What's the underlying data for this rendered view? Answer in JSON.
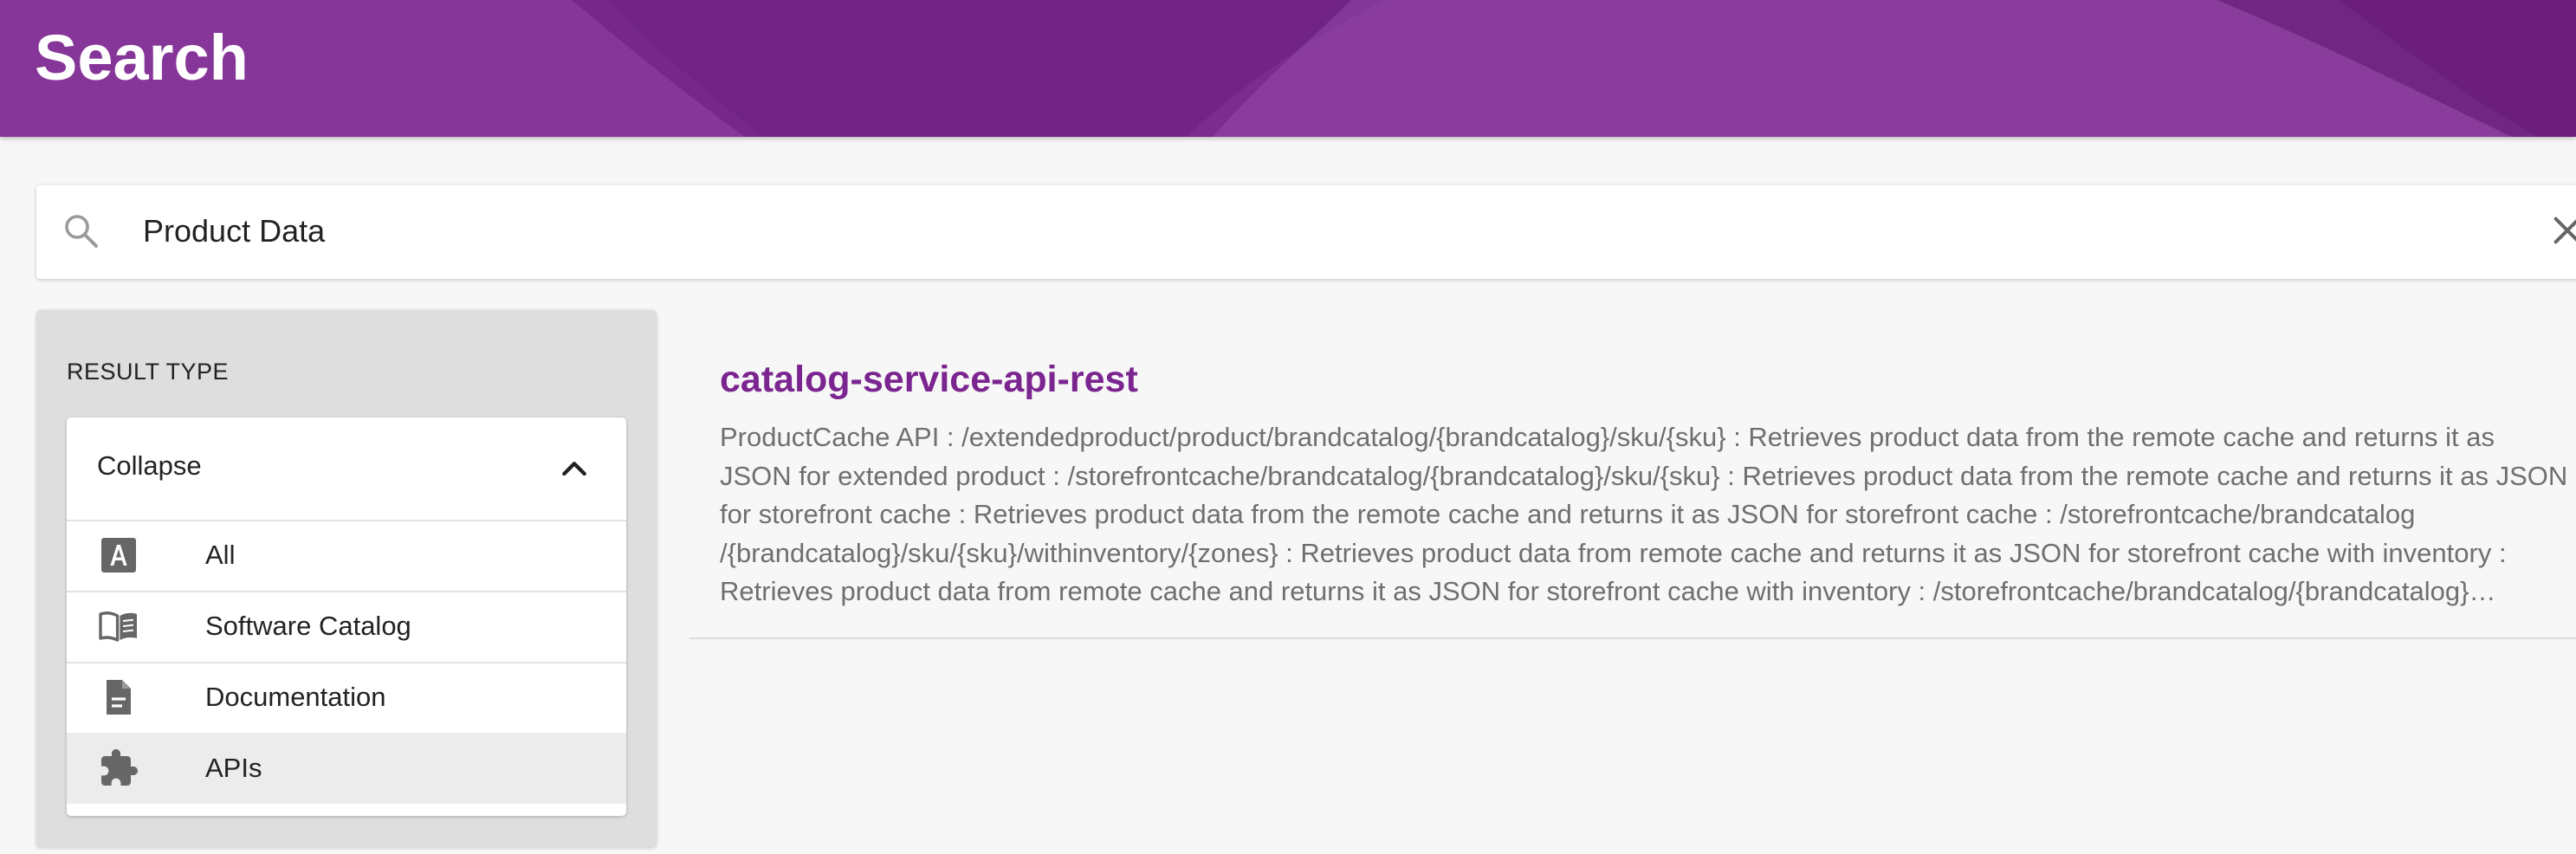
{
  "header": {
    "title": "Search",
    "color": "#7c2b8f"
  },
  "search": {
    "value": "Product Data",
    "icon": "search-icon",
    "clear_icon": "close-icon"
  },
  "filters": {
    "heading": "RESULT TYPE",
    "collapse_label": "Collapse",
    "items": [
      {
        "label": "All",
        "icon": "letter-a-icon"
      },
      {
        "label": "Software Catalog",
        "icon": "book-icon"
      },
      {
        "label": "Documentation",
        "icon": "document-icon"
      },
      {
        "label": "APIs",
        "icon": "puzzle-icon",
        "selected": true
      }
    ]
  },
  "results": [
    {
      "title": "catalog-service-api-rest",
      "title_color": "#7b2590",
      "text": "ProductCache API : /extendedproduct/product/brandcatalog/{brandcatalog}/sku/{sku} : Retrieves product data from the remote cache and returns it as JSON for extended product : /storefrontcache/brandcatalog/{brandcatalog}/sku/{sku} : Retrieves product data from the remote cache and returns it as JSON for storefront cache : Retrieves product data from the remote cache and returns it as JSON for storefront cache : /storefrontcache/brandcatalog /{brandcatalog}/sku/{sku}/withinventory/{zones} : Retrieves product data from remote cache and returns it as JSON for storefront cache with inventory : Retrieves product data from remote cache and returns it as JSON for storefront cache with inventory : /storefrontcache/brandcatalog/{brandcatalog}…"
    }
  ]
}
